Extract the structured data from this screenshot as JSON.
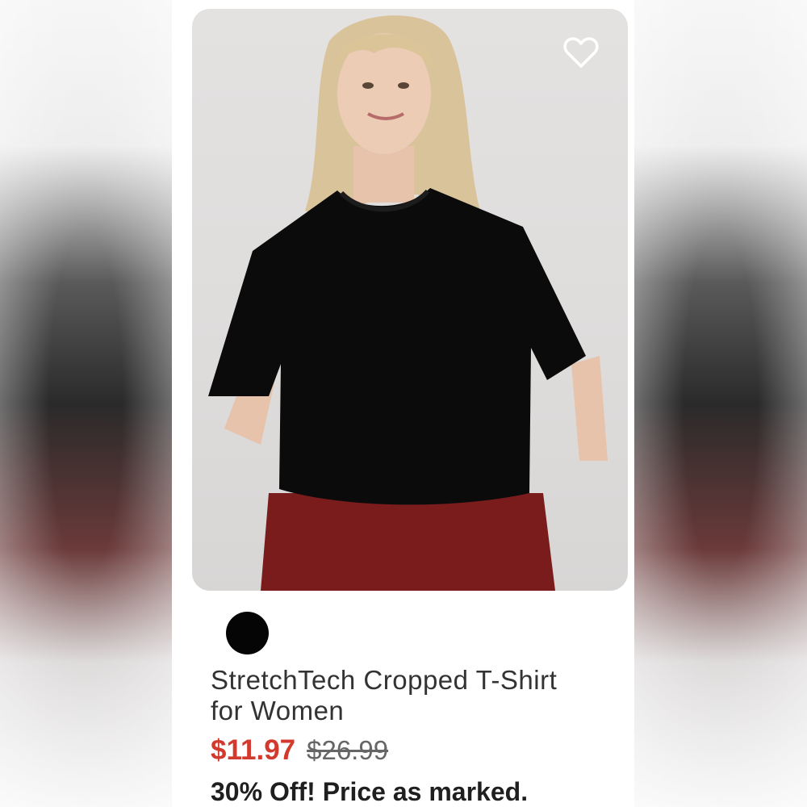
{
  "product": {
    "image_alt": "Woman wearing black cropped t-shirt",
    "favorite_icon": "heart-outline-icon",
    "color_swatches": [
      {
        "color": "#050505",
        "selected": true
      }
    ],
    "title": "StretchTech Cropped T-Shirt for Women",
    "sale_price": "$11.97",
    "original_price": "$26.99",
    "promo_text": "30% Off! Price as marked."
  },
  "colors": {
    "sale": "#d23a2e",
    "text": "#333333"
  }
}
